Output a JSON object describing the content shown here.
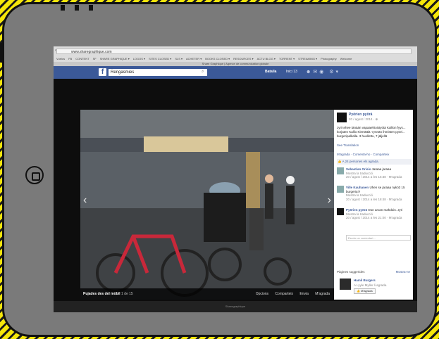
{
  "browser": {
    "url": "www.sharegraphique.com",
    "bookmarks": [
      "Vuelos",
      "FB",
      "CONTENT",
      "SF",
      "SHARE GRAPHIQUE ▾",
      "LOGOS ▾",
      "SITES CLOSED ▾",
      "SLS ▾",
      "ACHETER ▾",
      "BOOKS CLOSED ▾",
      "RESOURCES ▾",
      "ACTU BLOG ▾",
      "TORRENT ▾",
      "STREAMING ▾",
      "Photography",
      "Welcome"
    ],
    "brand_strip": "Share Graphique | Agence de communication globale"
  },
  "facebook": {
    "search_value": "Rengasmies",
    "user": "Batalla",
    "home_label": "Inici",
    "home_count": "13"
  },
  "photo": {
    "album_title": "Pujades des del mòbil",
    "counter": "1 de 15",
    "actions": [
      "Opcions",
      "Comparteix",
      "Envia",
      "M'agrada"
    ]
  },
  "post": {
    "page_name": "Pyörien pyörä",
    "date": "20 / agost / 2014 · ⊕",
    "text": "Jyri tehee tänään vapaaehtoistyötä Kallion fyys... korjaten Kallio Kierrättiä -rynnän ihmisten pyöri... burgeripalkalla. 3 huollettu, 7 jäljellä",
    "see_translation": "See Translation",
    "actions": "M'agrada · Comenta-ho · Comparteix",
    "likes": "👍 A 24 persones els agrada."
  },
  "comments": [
    {
      "name": "Sebastian Orisis",
      "text": "Jaraaa jaraaa",
      "meta": "Mostra la traducció",
      "time": "20 / agost / 2014 a les 16:38 · M'agrada"
    },
    {
      "name": "Ville Kauhanen",
      "text": "Uhen se jaraaa nykö3 15 burgeria?!",
      "meta": "Mostra la traducció",
      "time": "20 / agost / 2014 a les 18:48 · M'agrada"
    },
    {
      "name": "Pyörien pyörä",
      "text": "Oon arvan mahdoin. Jyri",
      "meta": "Mostra la traducció",
      "time": "20 / agost / 2014 a les 21:00 · M'agrada"
    }
  ],
  "write_comment_placeholder": "Escriu un comentari...",
  "suggested": {
    "header": "Pàgines suggerides",
    "see_all": "Mostra-ne",
    "name": "Hamil Burgers",
    "meta": "A Lyyle Myller li agrada.",
    "button": "👍 M'agrada"
  },
  "bottom_strip": "Sharegraphique",
  "colors": {
    "facebook_blue": "#3b5998",
    "hazard_yellow": "#f5e60a"
  }
}
